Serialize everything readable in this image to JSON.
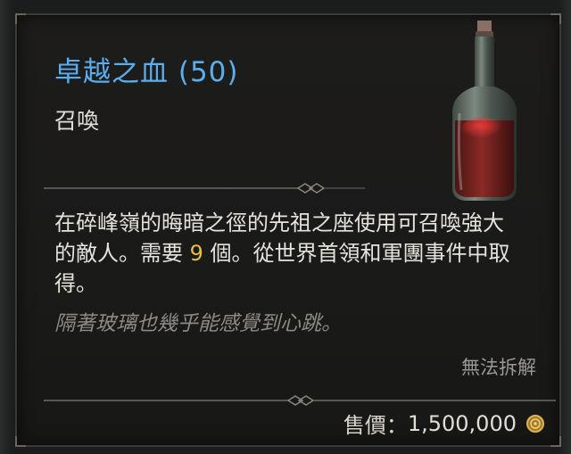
{
  "item": {
    "name": "卓越之血 (50)",
    "type": "召喚",
    "description": {
      "part1": "在碎峰嶺的晦暗之徑的先祖之座使用可召喚強大的敵人。需要 ",
      "quantity": "9",
      "part2": " 個。從世界首領和軍團事件中取得。"
    },
    "flavor_text": "隔著玻璃也幾乎能感覺到心跳。",
    "salvage_status": "無法拆解",
    "sell_price": {
      "label": "售價：",
      "value": "1,500,000",
      "currency_icon": "gold-coin-icon"
    },
    "icon": "blood-bottle-icon"
  },
  "colors": {
    "name": "#5aaef0",
    "quantity_highlight": "#e8bd45",
    "flavor": "#8d8a85",
    "body_text": "#e6e3dc"
  }
}
